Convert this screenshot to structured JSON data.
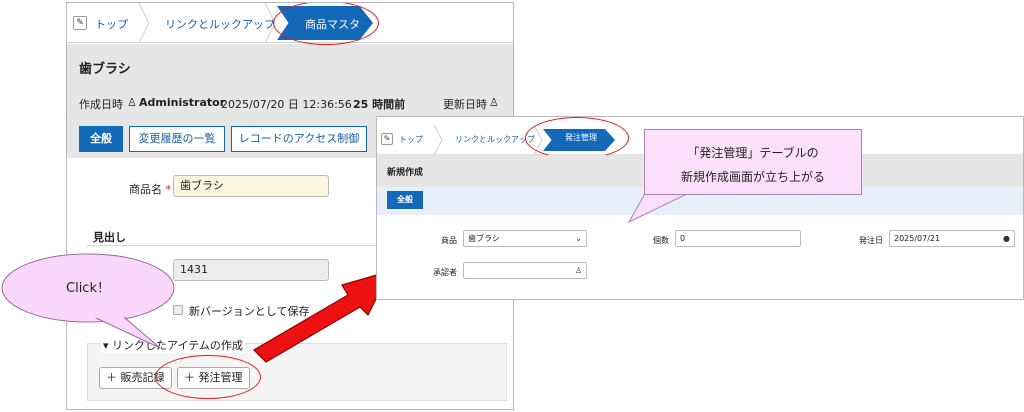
{
  "left": {
    "breadcrumb": [
      "トップ",
      "リンクとルックアップ",
      "商品マスタ"
    ],
    "record_title": "歯ブラシ",
    "meta": {
      "created_label": "作成日時",
      "user": "Administrator",
      "created_at": "2025/07/20 日 12:36:56",
      "ago": "25 時間前",
      "updated_label": "更新日時"
    },
    "tabs": [
      "全般",
      "変更履歴の一覧",
      "レコードのアクセス制御"
    ],
    "product_label": "商品名",
    "required_mark": "*",
    "product_value": "歯ブラシ",
    "section_heading": "見出し",
    "number_value": "1431",
    "save_version": "新バージョンとして保存",
    "linked_items": "▾ リンクしたアイテムの作成",
    "btn_sales": "＋ 販売記録",
    "btn_order": "＋ 発注管理"
  },
  "bubble": {
    "text": "Click！"
  },
  "right": {
    "breadcrumb": [
      "トップ",
      "リンクとルックアップ",
      "発注管理"
    ],
    "title": "新規作成",
    "tab": "全般",
    "fields": {
      "product_label": "商品",
      "product_value": "歯ブラシ",
      "qty_label": "個数",
      "qty_value": "0",
      "date_label": "発注日",
      "date_value": "2025/07/21",
      "approver_label": "承認者"
    }
  },
  "callout": {
    "line1": "「発注管理」テーブルの",
    "line2": "新規作成画面が立ち上がる"
  },
  "colors": {
    "accent": "#1368b8",
    "annotation_red": "#e02020",
    "bubble": "#fbd8fb",
    "arrow": "#ee1111"
  },
  "icons": [
    "edit-icon",
    "user-icon",
    "calendar-icon",
    "chevron-down-icon",
    "plus-icon"
  ]
}
